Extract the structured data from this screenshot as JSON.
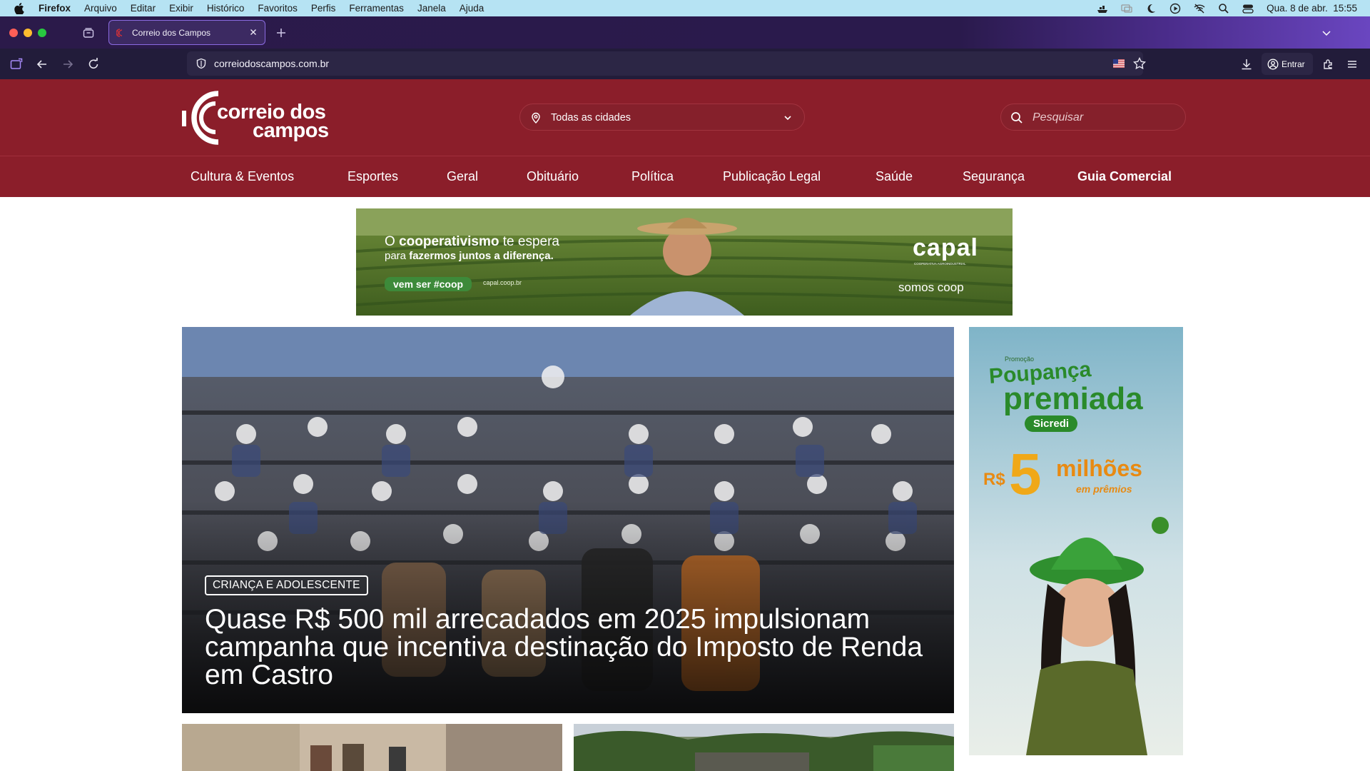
{
  "menubar": {
    "app": "Firefox",
    "items": [
      "Arquivo",
      "Editar",
      "Exibir",
      "Histórico",
      "Favoritos",
      "Perfis",
      "Ferramentas",
      "Janela",
      "Ajuda"
    ],
    "clock": "Qua. 8 de abr.  15:55"
  },
  "browser": {
    "tab_title": "Correio dos Campos",
    "url": "correiodoscampos.com.br",
    "signin_label": "Entrar"
  },
  "site": {
    "logo_line1": "correio dos",
    "logo_line2": "campos",
    "city_select": "Todas as cidades",
    "search_placeholder": "Pesquisar",
    "categories": [
      "Cultura & Eventos",
      "Esportes",
      "Geral",
      "Obituário",
      "Política",
      "Publicação Legal",
      "Saúde",
      "Segurança",
      "Guia Comercial"
    ]
  },
  "top_ad": {
    "line1_a": "O ",
    "line1_b": "cooperativismo",
    "line1_c": " te espera",
    "line2_a": "para ",
    "line2_b": "fazermos juntos a diferença.",
    "cta": "vem ser #coop",
    "site": "capal.coop.br",
    "brand": "capal",
    "brand_sub": "COOPERATIVA AGROINDUSTRIAL",
    "tagline": "somos coop"
  },
  "hero": {
    "tag": "CRIANÇA E ADOLESCENTE",
    "title": "Quase R$ 500 mil arrecadados em 2025 impulsionam campanha que incentiva destinação do Imposto de Renda em Castro"
  },
  "side_ad": {
    "promo": "Promoção",
    "title1": "Poupança",
    "title2": "premiada",
    "brand": "Sicredi",
    "currency": "R$",
    "amount": "5",
    "unit": "milhões",
    "sub": "em prêmios"
  },
  "colors": {
    "brand_red": "#8b1e2a",
    "browser_bg": "#221c3a",
    "menubar": "#b6e3f3"
  }
}
